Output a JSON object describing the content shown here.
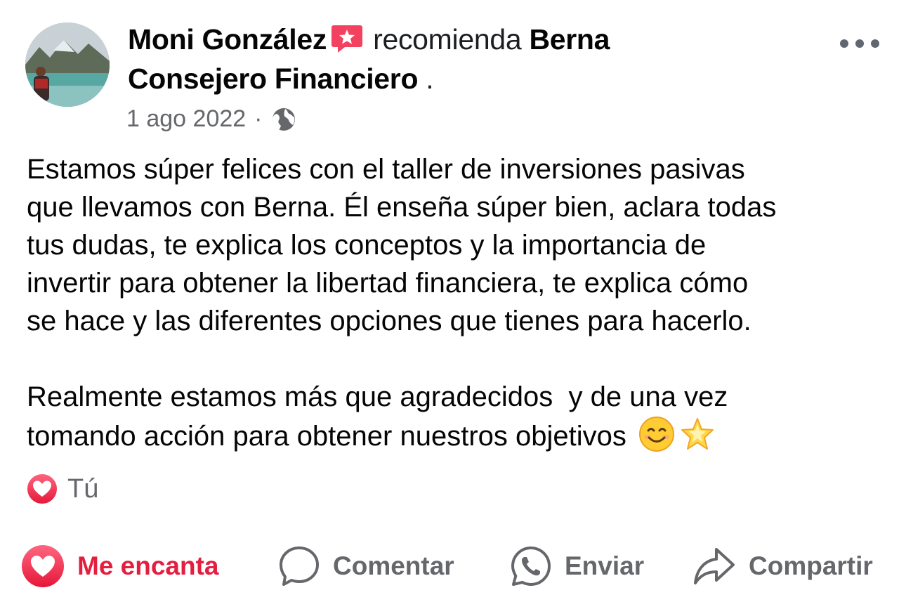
{
  "post": {
    "author": "Moni González",
    "verb": "recomienda",
    "page_name_line1": "Berna",
    "page_name_line2": "Consejero Financiero",
    "trailing_period": " .",
    "date": "1 ago 2022",
    "separator": "·",
    "privacy_icon": "globe-icon",
    "paragraph1": "Estamos súper felices con el taller de inversiones pasivas\nque llevamos con Berna. Él enseña súper bien, aclara todas\ntus dudas, te explica los conceptos y la importancia de\ninvertir para obtener la libertad financiera, te explica cómo\nse hace y las diferentes opciones que tienes para hacerlo.",
    "paragraph2": "Realmente estamos más que agradecidos  y de una vez\ntomando acción para obtener nuestros objetivos",
    "emojis": [
      "smiling-face-emoji",
      "glowing-star-emoji"
    ]
  },
  "reactions": {
    "icon": "love-reaction-icon",
    "who": "Tú"
  },
  "actions": {
    "love_label": "Me encanta",
    "comment_label": "Comentar",
    "send_label": "Enviar",
    "share_label": "Compartir"
  },
  "colors": {
    "love_red": "#e41e3f",
    "secondary_text": "#65676b",
    "recommend_badge": "#f3425f"
  }
}
